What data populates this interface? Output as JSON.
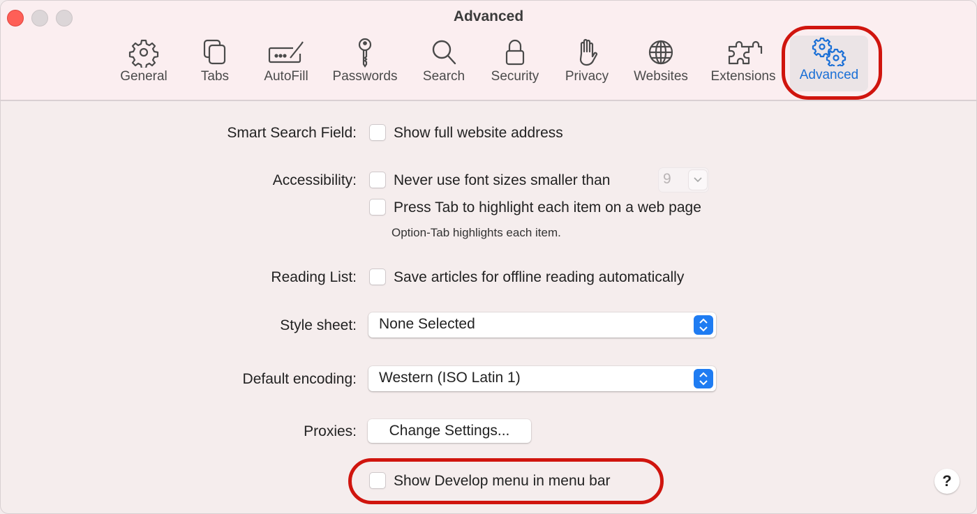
{
  "window": {
    "title": "Advanced",
    "traffic_lights": [
      "close",
      "minimize",
      "maximize"
    ]
  },
  "toolbar": {
    "items": [
      {
        "label": "General",
        "icon": "gear-icon",
        "active": false
      },
      {
        "label": "Tabs",
        "icon": "tabs-icon",
        "active": false
      },
      {
        "label": "AutoFill",
        "icon": "autofill-icon",
        "active": false
      },
      {
        "label": "Passwords",
        "icon": "key-icon",
        "active": false
      },
      {
        "label": "Search",
        "icon": "search-icon",
        "active": false
      },
      {
        "label": "Security",
        "icon": "lock-icon",
        "active": false
      },
      {
        "label": "Privacy",
        "icon": "hand-icon",
        "active": false
      },
      {
        "label": "Websites",
        "icon": "globe-icon",
        "active": false
      },
      {
        "label": "Extensions",
        "icon": "puzzle-icon",
        "active": false
      },
      {
        "label": "Advanced",
        "icon": "gears-icon",
        "active": true
      }
    ],
    "active_color": "#1a6fd6"
  },
  "settings": {
    "smart_search": {
      "label": "Smart Search Field:",
      "option": "Show full website address",
      "checked": false
    },
    "accessibility": {
      "label": "Accessibility:",
      "font_option": "Never use font sizes smaller than",
      "font_option_checked": false,
      "font_size_value": "9",
      "tab_option": "Press Tab to highlight each item on a web page",
      "tab_option_checked": false,
      "hint": "Option-Tab highlights each item."
    },
    "reading_list": {
      "label": "Reading List:",
      "option": "Save articles for offline reading automatically",
      "checked": false
    },
    "style_sheet": {
      "label": "Style sheet:",
      "value": "None Selected"
    },
    "default_encoding": {
      "label": "Default encoding:",
      "value": "Western (ISO Latin 1)"
    },
    "proxies": {
      "label": "Proxies:",
      "button": "Change Settings..."
    },
    "develop_menu": {
      "option": "Show Develop menu in menu bar",
      "checked": false
    }
  },
  "help": {
    "label": "?"
  },
  "annotations": {
    "highlight_color": "#d0150e"
  }
}
